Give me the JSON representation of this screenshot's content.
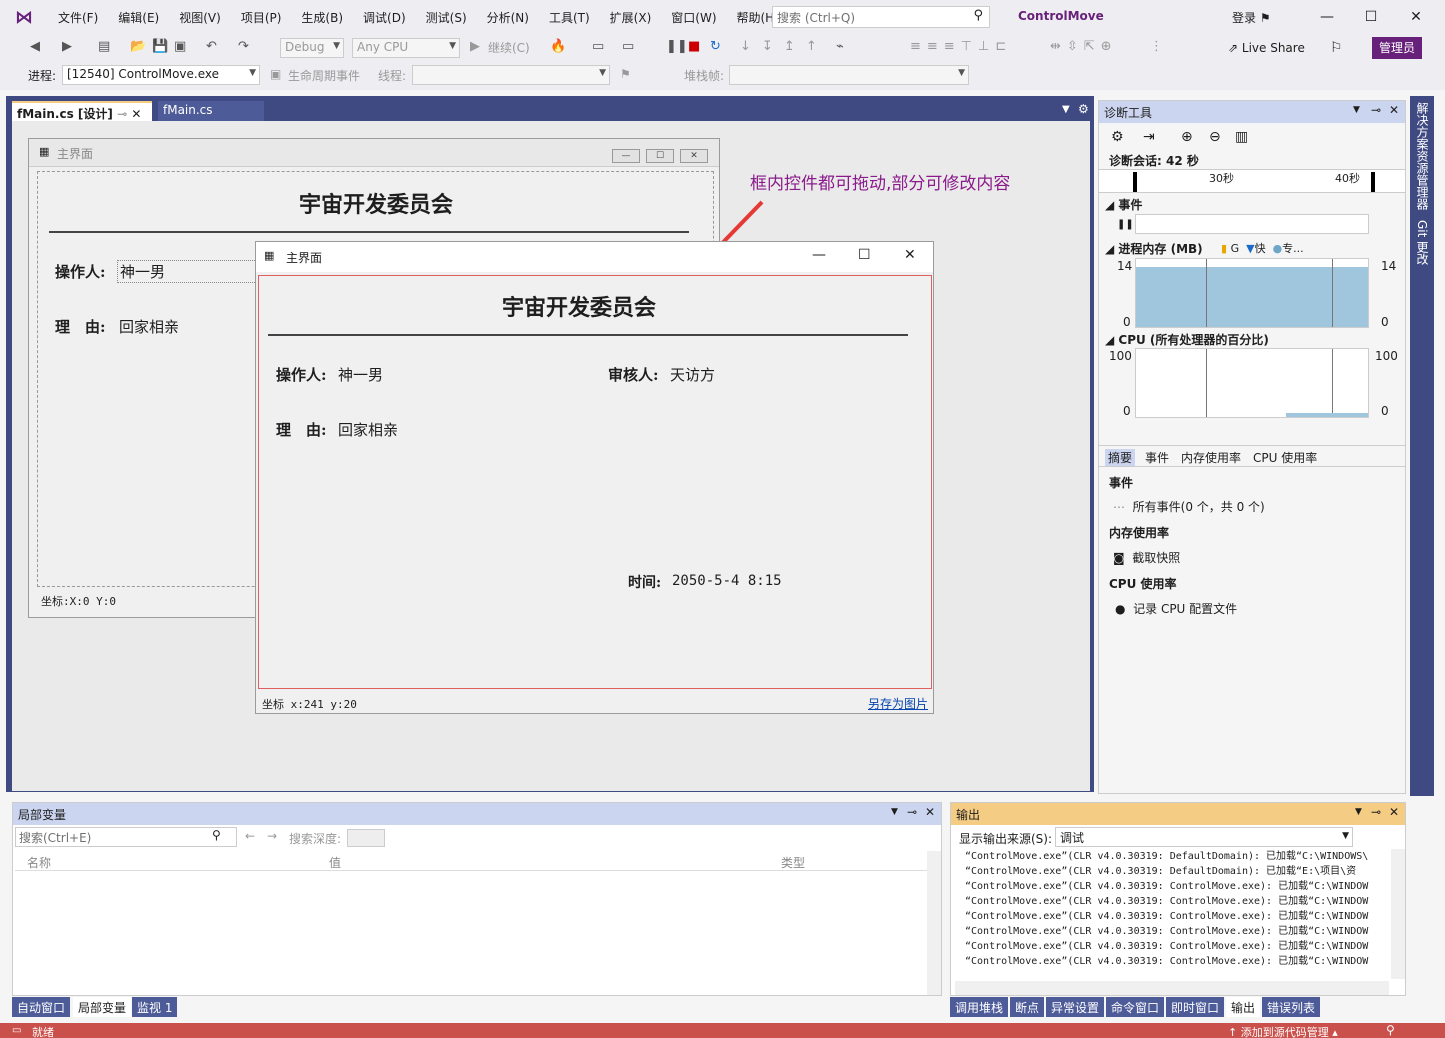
{
  "menu": {
    "items": [
      "文件(F)",
      "编辑(E)",
      "视图(V)",
      "项目(P)",
      "生成(B)",
      "调试(D)",
      "测试(S)",
      "分析(N)",
      "工具(T)",
      "扩展(X)",
      "窗口(W)",
      "帮助(H)"
    ],
    "search_placeholder": "搜索 (Ctrl+Q)",
    "app_title": "ControlMove",
    "login": "登录"
  },
  "toolbar": {
    "config": "Debug",
    "platform": "Any CPU",
    "continue": "继续(C)",
    "live_share": "Live Share",
    "admin": "管理员",
    "process_label": "进程:",
    "process_value": "[12540] ControlMove.exe",
    "lifecycle": "生命周期事件",
    "thread_label": "线程:",
    "stackframe_label": "堆栈帧:"
  },
  "doc_tabs": {
    "active": "fMain.cs [设计]",
    "second": "fMain.cs"
  },
  "annotation": "框内控件都可拖动,部分可修改内容",
  "designer_form": {
    "title": "主界面",
    "heading": "宇宙开发委员会",
    "operator_label": "操作人:",
    "operator_value": "神一男",
    "reason_label": "理　由:",
    "reason_value": "回家相亲",
    "coord": "坐标:X:0 Y:0"
  },
  "runtime_form": {
    "title": "主界面",
    "heading": "宇宙开发委员会",
    "operator_label": "操作人:",
    "operator_value": "神一男",
    "reviewer_label": "审核人:",
    "reviewer_value": "天访方",
    "reason_label": "理　由:",
    "reason_value": "回家相亲",
    "time_label": "时间:",
    "time_value": "2050-5-4 8:15",
    "coord": "坐标 x:241 y:20",
    "save_link": "另存为图片"
  },
  "diagnostics": {
    "title": "诊断工具",
    "session": "诊断会话: 42 秒",
    "tick_30": "30秒",
    "tick_40": "40秒",
    "events_label": "事件",
    "memory_label": "进程内存 (MB)",
    "memory_legend": [
      "G",
      "快",
      "专..."
    ],
    "memory_max": "14",
    "memory_min": "0",
    "cpu_label": "CPU (所有处理器的百分比)",
    "cpu_max": "100",
    "cpu_min": "0",
    "tabs": [
      "摘要",
      "事件",
      "内存使用率",
      "CPU 使用率"
    ],
    "sec_events": "事件",
    "all_events": "所有事件(0 个，共 0 个)",
    "sec_memory": "内存使用率",
    "snapshot": "截取快照",
    "sec_cpu": "CPU 使用率",
    "record_cpu": "记录 CPU 配置文件"
  },
  "side_strip": [
    "解决方案资源管理器",
    "Git 更改"
  ],
  "locals": {
    "title": "局部变量",
    "search_placeholder": "搜索(Ctrl+E)",
    "depth_label": "搜索深度:",
    "col_name": "名称",
    "col_value": "值",
    "col_type": "类型",
    "tabs": [
      "自动窗口",
      "局部变量",
      "监视 1"
    ]
  },
  "output": {
    "title": "输出",
    "source_label": "显示输出来源(S):",
    "source_value": "调试",
    "lines": [
      "“ControlMove.exe”(CLR v4.0.30319: DefaultDomain): 已加载“C:\\WINDOWS\\",
      "“ControlMove.exe”(CLR v4.0.30319: DefaultDomain): 已加载“E:\\项目\\资",
      "“ControlMove.exe”(CLR v4.0.30319: ControlMove.exe): 已加载“C:\\WINDOW",
      "“ControlMove.exe”(CLR v4.0.30319: ControlMove.exe): 已加载“C:\\WINDOW",
      "“ControlMove.exe”(CLR v4.0.30319: ControlMove.exe): 已加载“C:\\WINDOW",
      "“ControlMove.exe”(CLR v4.0.30319: ControlMove.exe): 已加载“C:\\WINDOW",
      "“ControlMove.exe”(CLR v4.0.30319: ControlMove.exe): 已加载“C:\\WINDOW",
      "“ControlMove.exe”(CLR v4.0.30319: ControlMove.exe): 已加载“C:\\WINDOW"
    ],
    "tabs": [
      "调用堆栈",
      "断点",
      "异常设置",
      "命令窗口",
      "即时窗口",
      "输出",
      "错误列表"
    ]
  },
  "status": {
    "ready": "就绪",
    "source_control": "添加到源代码管理"
  }
}
